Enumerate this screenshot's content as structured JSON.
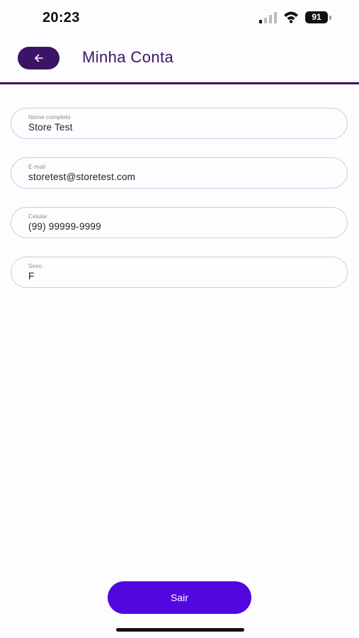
{
  "status_bar": {
    "time": "20:23",
    "battery": "91"
  },
  "header": {
    "title": "Minha Conta",
    "back_icon": "arrow-left-icon"
  },
  "fields": [
    {
      "label": "Nome completo",
      "value": "Store Test"
    },
    {
      "label": "E-mail",
      "value": "storetest@storetest.com"
    },
    {
      "label": "Celular",
      "value": "(99) 99999-9999"
    },
    {
      "label": "Sexo",
      "value": "F"
    }
  ],
  "logout_button": {
    "label": "Sair"
  },
  "colors": {
    "brand": "#3b1466",
    "button": "#5207e0"
  }
}
